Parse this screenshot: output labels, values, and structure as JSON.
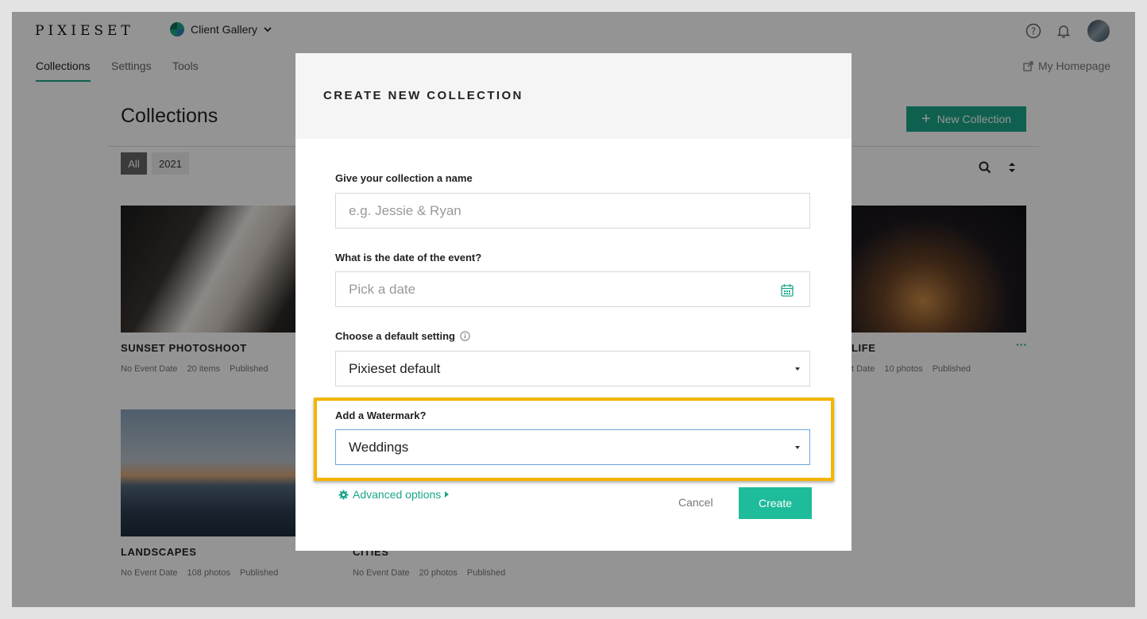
{
  "app": {
    "logo": "PIXIESET",
    "product": "Client Gallery"
  },
  "nav": {
    "tabs": [
      "Collections",
      "Settings",
      "Tools"
    ],
    "homepage": "My Homepage"
  },
  "page": {
    "title": "Collections",
    "new_button": "New Collection"
  },
  "filters": [
    "All",
    "2021"
  ],
  "cards": [
    {
      "title": "SUNSET PHOTOSHOOT",
      "date": "No Event Date",
      "count": "20 items",
      "status": "Published"
    },
    {
      "title": "LIFE",
      "date": "t Date",
      "count": "10 photos",
      "status": "Published",
      "menu": "···"
    },
    {
      "title": "LANDSCAPES",
      "date": "No Event Date",
      "count": "108 photos",
      "status": "Published"
    },
    {
      "title": "CITIES",
      "date": "No Event Date",
      "count": "20 photos",
      "status": "Published"
    }
  ],
  "modal": {
    "title": "CREATE NEW COLLECTION",
    "name_label": "Give your collection a name",
    "name_placeholder": "e.g. Jessie & Ryan",
    "date_label": "What is the date of the event?",
    "date_placeholder": "Pick a date",
    "setting_label": "Choose a default setting",
    "setting_value": "Pixieset default",
    "watermark_label": "Add a Watermark?",
    "watermark_value": "Weddings",
    "advanced": "Advanced options",
    "cancel": "Cancel",
    "create": "Create"
  },
  "colors": {
    "accent": "#1aa688",
    "create": "#1ebc9a",
    "highlight": "#f4b400"
  }
}
